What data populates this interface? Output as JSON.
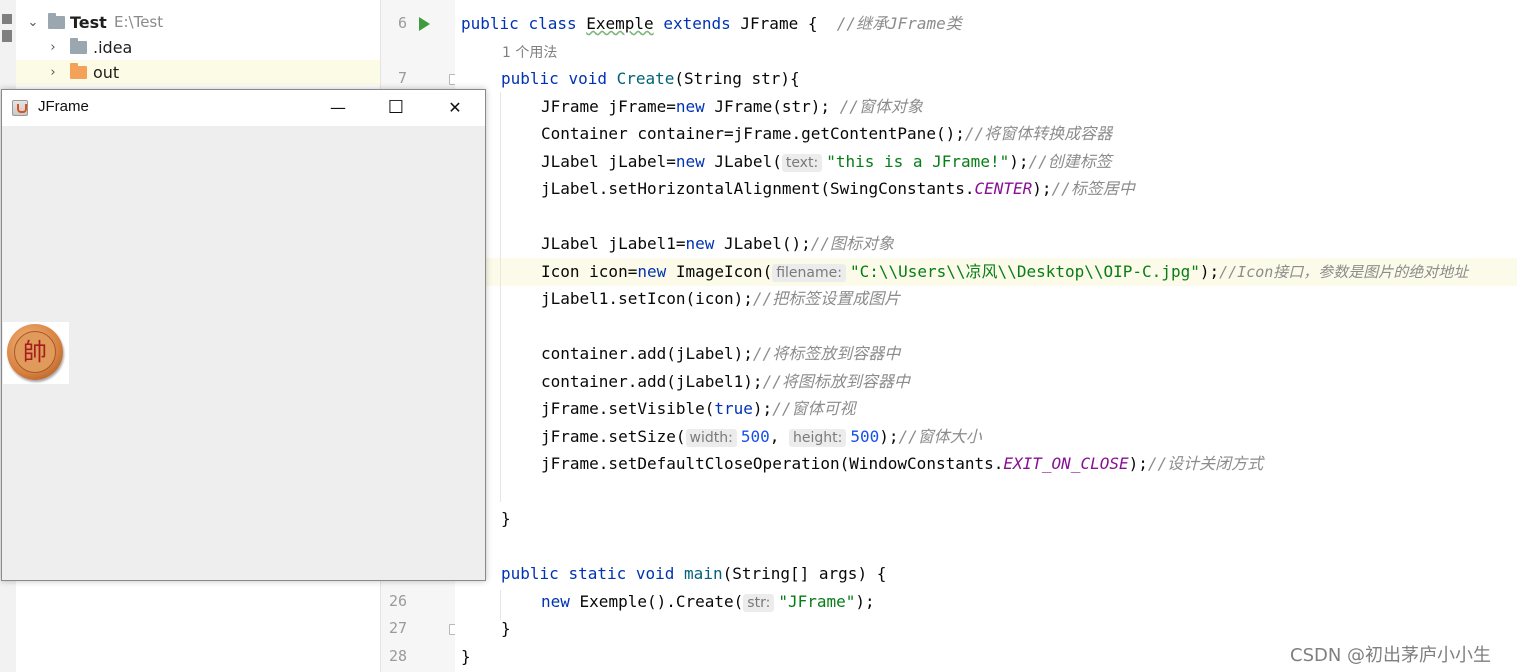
{
  "project": {
    "root": {
      "name": "Test",
      "path": "E:\\Test"
    },
    "items": [
      {
        "name": ".idea",
        "color": "#9aa7b0"
      },
      {
        "name": "out",
        "color": "#f4a259"
      }
    ]
  },
  "jframe": {
    "title": "JFrame",
    "minimize": "—",
    "maximize": "☐",
    "close": "✕",
    "label_icon_char": "帥"
  },
  "editor": {
    "usage_hint": "1 个用法",
    "line_numbers": [
      {
        "n": "6"
      },
      {
        "n": "7"
      },
      {
        "n": "26"
      },
      {
        "n": "27"
      },
      {
        "n": "28"
      }
    ],
    "lines": {
      "l1_a": "public",
      "l1_b": "class",
      "l1_c": "Exemple",
      "l1_d": "extends",
      "l1_e": "JFrame {",
      "l1_cmt": "//继承JFrame类",
      "l2_a": "public",
      "l2_b": "void",
      "l2_c": "Create",
      "l2_d": "(String str){",
      "l3_a": "JFrame jFrame=",
      "l3_b": "new",
      "l3_c": " JFrame(str); ",
      "l3_cmt": "//窗体对象",
      "l4_a": "Container container=jFrame.getContentPane();",
      "l4_cmt": "//将窗体转换成容器",
      "l5_a": "JLabel jLabel=",
      "l5_b": "new",
      "l5_c": " JLabel(",
      "l5_hint": "text:",
      "l5_str": "\"this is a JFrame!\"",
      "l5_d": ");",
      "l5_cmt": "//创建标签",
      "l6_a": "jLabel.setHorizontalAlignment(SwingConstants.",
      "l6_const": "CENTER",
      "l6_b": ");",
      "l6_cmt": "//标签居中",
      "l7_a": "JLabel jLabel1=",
      "l7_b": "new",
      "l7_c": " JLabel();",
      "l7_cmt": "//图标对象",
      "l8_a": "Icon icon=",
      "l8_b": "new",
      "l8_c": " ImageIcon(",
      "l8_hint": "filename:",
      "l8_str": "\"C:\\\\Users\\\\凉风\\\\Desktop\\\\OIP-C.jpg\"",
      "l8_d": ");",
      "l8_cmt": "//Icon接口，参数是图片的绝对地址",
      "l9_a": "jLabel1.setIcon(icon);",
      "l9_cmt": "//把标签设置成图片",
      "l10_a": "container.add(jLabel);",
      "l10_cmt": "//将标签放到容器中",
      "l11_a": "container.add(jLabel1);",
      "l11_cmt": "//将图标放到容器中",
      "l12_a": "jFrame.setVisible(",
      "l12_kw": "true",
      "l12_b": ");",
      "l12_cmt": "//窗体可视",
      "l13_a": "jFrame.setSize(",
      "l13_h1": "width:",
      "l13_n1": "500",
      "l13_b": ", ",
      "l13_h2": "height:",
      "l13_n2": "500",
      "l13_c": ");",
      "l13_cmt": "//窗体大小",
      "l14_a": "jFrame.setDefaultCloseOperation(WindowConstants.",
      "l14_const": "EXIT_ON_CLOSE",
      "l14_b": ");",
      "l14_cmt": "//设计关闭方式",
      "l15": "}",
      "l16_a": "public",
      "l16_b": "static",
      "l16_c": "void",
      "l16_d": "main",
      "l16_e": "(String[] args) {",
      "l17_a": "new",
      "l17_b": " Exemple().Create(",
      "l17_hint": "str:",
      "l17_str": "\"JFrame\"",
      "l17_c": ");",
      "l18": "}",
      "l19": "}"
    }
  },
  "watermark": "CSDN @初出茅庐小小生"
}
